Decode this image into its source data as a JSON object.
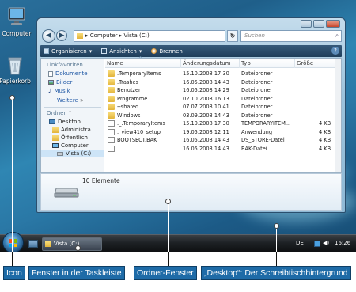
{
  "desktop": {
    "icons": [
      {
        "label": "Computer",
        "icon": "computer-icon"
      },
      {
        "label": "Papierkorb",
        "icon": "recycle-bin-icon"
      }
    ]
  },
  "window": {
    "address_path": "▸ Computer ▸ Vista (C:)",
    "search_placeholder": "Suchen",
    "toolbar": {
      "organize": "Organisieren",
      "views": "Ansichten",
      "burn": "Brennen"
    },
    "nav_pane": {
      "favorites_heading": "Linkfavoriten",
      "favorites": [
        "Dokumente",
        "Bilder",
        "Musik"
      ],
      "more_label": "Weitere",
      "folders_heading": "Ordner",
      "tree": [
        "Desktop",
        "Administra",
        "Öffentlich",
        "Computer",
        "Vista (C:)"
      ]
    },
    "columns": {
      "name": "Name",
      "date": "Änderungsdatum",
      "type": "Typ",
      "size": "Größe"
    },
    "files": [
      {
        "name": ".TemporaryItems",
        "date": "15.10.2008 17:30",
        "type": "Dateiordner",
        "size": "",
        "kind": "folder"
      },
      {
        "name": ".Trashes",
        "date": "16.05.2008 14:43",
        "type": "Dateiordner",
        "size": "",
        "kind": "folder"
      },
      {
        "name": "Benutzer",
        "date": "16.05.2008 14:29",
        "type": "Dateiordner",
        "size": "",
        "kind": "folder"
      },
      {
        "name": "Programme",
        "date": "02.10.2008 16:13",
        "type": "Dateiordner",
        "size": "",
        "kind": "folder"
      },
      {
        "name": "--shared",
        "date": "07.07.2008 10:41",
        "type": "Dateiordner",
        "size": "",
        "kind": "folder"
      },
      {
        "name": "Windows",
        "date": "03.09.2008 14:43",
        "type": "Dateiordner",
        "size": "",
        "kind": "folder"
      },
      {
        "name": "._.TemporaryItems",
        "date": "15.10.2008 17:30",
        "type": "TEMPORARYITEM...",
        "size": "4 KB",
        "kind": "file"
      },
      {
        "name": "._view410_setup",
        "date": "19.05.2008 12:11",
        "type": "Anwendung",
        "size": "4 KB",
        "kind": "file"
      },
      {
        "name": "BOOTSECT.BAK",
        "date": "16.05.2008 14:43",
        "type": "DS_STORE-Datei",
        "size": "4 KB",
        "kind": "file"
      },
      {
        "name": "",
        "date": "16.05.2008 14:43",
        "type": "BAK-Datei",
        "size": "4 KB",
        "kind": "file"
      }
    ],
    "status_count": "10 Elemente"
  },
  "taskbar": {
    "task_label": "Vista (C:)",
    "language": "DE",
    "clock": "16:26"
  },
  "captions": {
    "icon": "Icon",
    "taskbar_window": "Fenster in der Taskleiste",
    "folder_window": "Ordner-Fenster",
    "desktop": "„Desktop“: Der Schreibtischhintergrund"
  },
  "colors": {
    "caption_bg": "#1e6ba7",
    "toolbar_bg": "#2a4a68",
    "desktop_bg": "#2a78a6"
  }
}
